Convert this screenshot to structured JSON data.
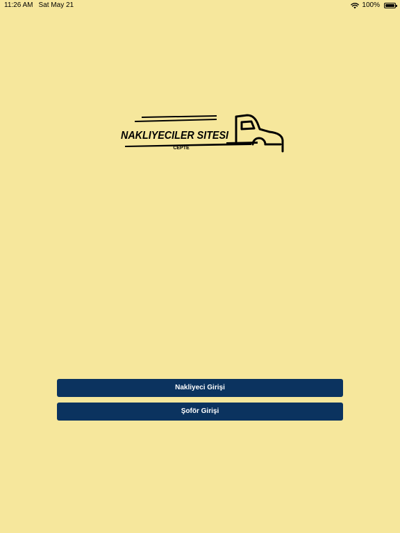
{
  "status_bar": {
    "time": "11:26 AM",
    "date": "Sat May 21",
    "battery_percent": "100%",
    "battery_level": 1.0,
    "wifi_icon": "wifi-icon",
    "battery_icon": "battery-icon"
  },
  "logo": {
    "title": "NAKLIYECILER SITESI",
    "subtitle": "CEPTE",
    "icon": "truck-icon"
  },
  "buttons": {
    "carrier_login": "Nakliyeci Girişi",
    "driver_login": "Şoför Girişi"
  },
  "colors": {
    "background": "#f6e79c",
    "button": "#0b335f",
    "button_text": "#ffffff"
  }
}
